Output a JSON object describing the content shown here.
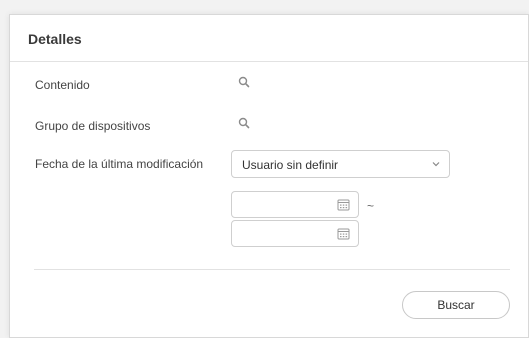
{
  "panel": {
    "title": "Detalles"
  },
  "fields": {
    "content_label": "Contenido",
    "device_group_label": "Grupo de dispositivos",
    "last_modified_label": "Fecha de la última modificación",
    "last_modified_select_value": "Usuario sin definir",
    "range_separator": "~"
  },
  "actions": {
    "search_label": "Buscar"
  },
  "icons": {
    "content_search": "search-icon",
    "device_group_search": "search-icon",
    "select_chevron": "chevron-down-icon",
    "date_picker": "calendar-icon"
  }
}
